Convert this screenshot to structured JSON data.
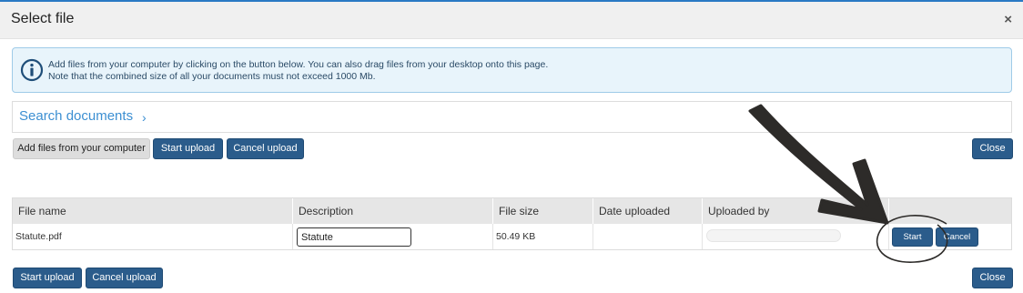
{
  "dialog": {
    "title": "Select file",
    "close_icon": "×"
  },
  "info": {
    "icon": "info-icon",
    "line1": "Add files from your computer by clicking on the button below. You can also drag files from your desktop onto this page.",
    "line2": "Note that the combined size of all your documents must not exceed 1000 Mb."
  },
  "search": {
    "label": "Search documents",
    "chevron": "›"
  },
  "toolbar": {
    "add_files": "Add files from your computer",
    "start_upload": "Start upload",
    "cancel_upload": "Cancel upload",
    "close": "Close"
  },
  "table": {
    "columns": [
      "File name",
      "Description",
      "File size",
      "Date uploaded",
      "Uploaded by",
      ""
    ],
    "rows": [
      {
        "file_name": "Statute.pdf",
        "description": "Statute",
        "file_size": "50.49 KB",
        "date_uploaded": "",
        "uploaded_by": "",
        "progress_percent": 0,
        "start": "Start",
        "cancel": "Cancel"
      }
    ]
  },
  "footer": {
    "start_upload": "Start upload",
    "cancel_upload": "Cancel upload",
    "close": "Close"
  },
  "colors": {
    "accent": "#2b5c8b",
    "link": "#3c8fd2",
    "info_bg": "#e8f4fb",
    "annotation": "#2d2b29"
  }
}
